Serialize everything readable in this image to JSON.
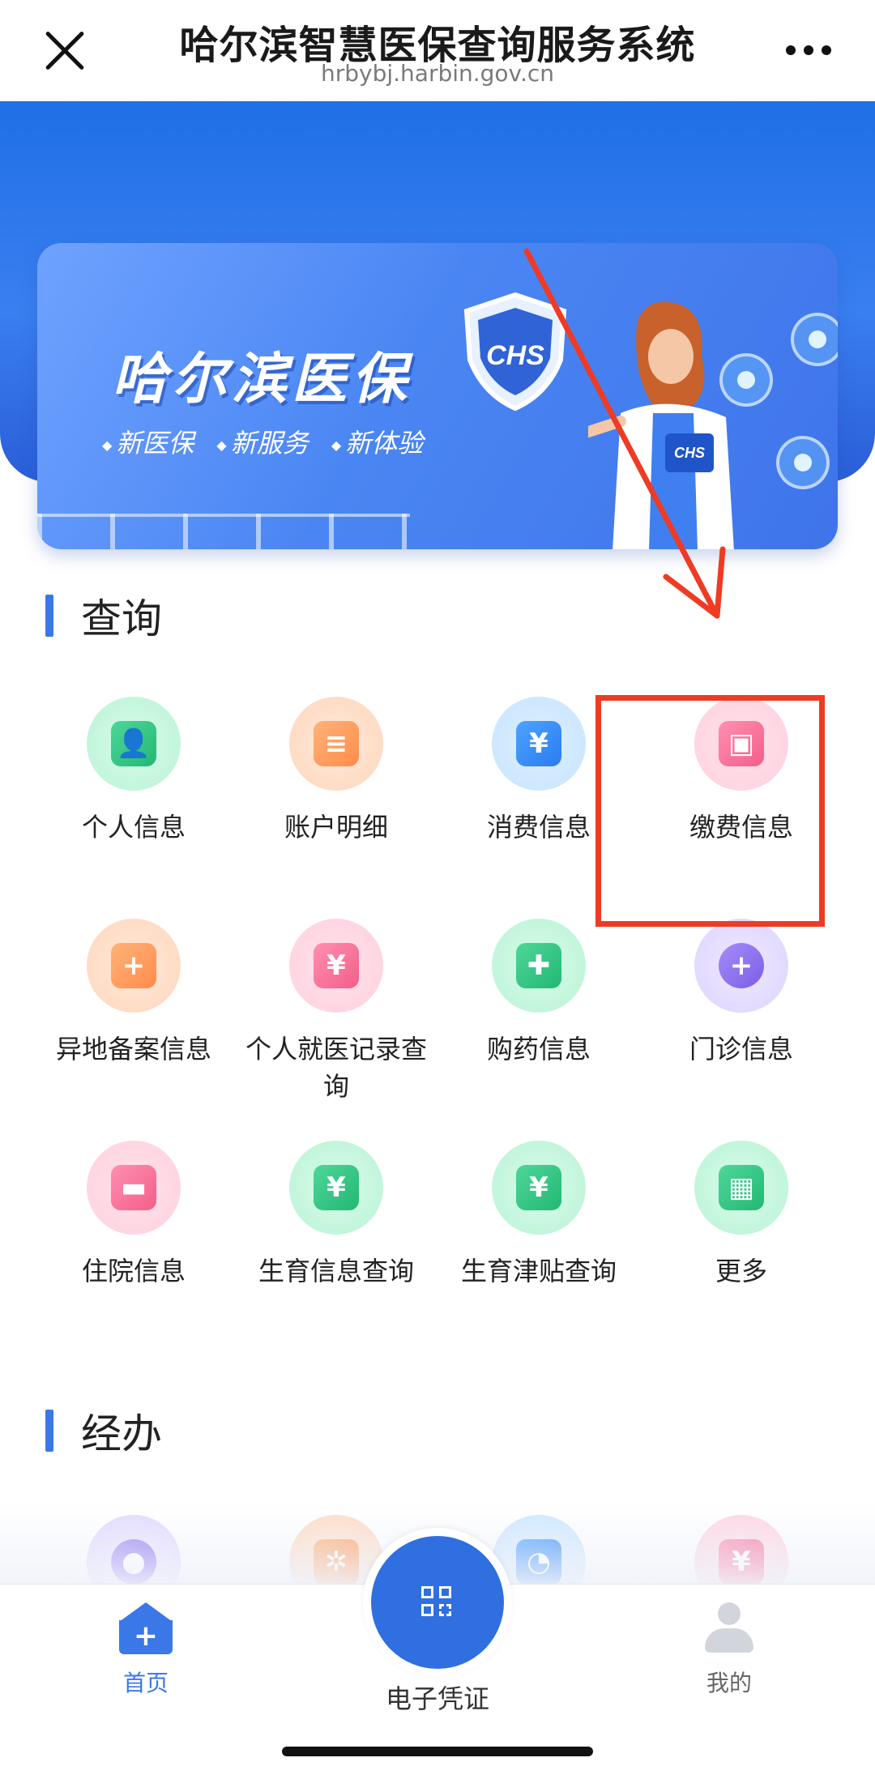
{
  "header": {
    "title": "哈尔滨智慧医保查询服务系统",
    "url": "hrbybj.harbin.gov.cn"
  },
  "banner": {
    "title": "哈尔滨医保",
    "tags": [
      "新医保",
      "新服务",
      "新体验"
    ],
    "shield_text": "CHS",
    "badge_text": "CHS"
  },
  "query_section": {
    "title": "查询",
    "items": [
      {
        "label": "个人信息",
        "icon": "person-card-icon",
        "color": "green",
        "glyph": "👤"
      },
      {
        "label": "账户明细",
        "icon": "account-detail-icon",
        "color": "orange",
        "glyph": "≡"
      },
      {
        "label": "消费信息",
        "icon": "consumption-icon",
        "color": "blue",
        "glyph": "¥"
      },
      {
        "label": "缴费信息",
        "icon": "payment-icon",
        "color": "pink",
        "glyph": "▣"
      },
      {
        "label": "异地备案信息",
        "icon": "remote-filing-icon",
        "color": "orange",
        "glyph": "+"
      },
      {
        "label": "个人就医记录查询",
        "icon": "medical-record-icon",
        "color": "pink",
        "glyph": "¥"
      },
      {
        "label": "购药信息",
        "icon": "medicine-purchase-icon",
        "color": "green",
        "glyph": "✚"
      },
      {
        "label": "门诊信息",
        "icon": "outpatient-icon",
        "color": "purple",
        "glyph": "+"
      },
      {
        "label": "住院信息",
        "icon": "hospitalization-icon",
        "color": "pink",
        "glyph": "▬"
      },
      {
        "label": "生育信息查询",
        "icon": "maternity-info-icon",
        "color": "green",
        "glyph": "¥"
      },
      {
        "label": "生育津贴查询",
        "icon": "maternity-allowance-icon",
        "color": "green",
        "glyph": "¥"
      },
      {
        "label": "更多",
        "icon": "more-apps-icon",
        "color": "green",
        "glyph": "▦"
      }
    ]
  },
  "handle_section": {
    "title": "经办",
    "items": [
      {
        "icon": "location-service-icon",
        "color": "purple",
        "glyph": "●"
      },
      {
        "icon": "settings-service-icon",
        "color": "orange",
        "glyph": "✲"
      },
      {
        "icon": "chat-service-icon",
        "color": "blue",
        "glyph": "◔"
      },
      {
        "icon": "bill-service-icon",
        "color": "pink",
        "glyph": "¥"
      }
    ]
  },
  "bottom_nav": {
    "home_label": "首页",
    "voucher_label": "电子凭证",
    "mine_label": "我的"
  },
  "colors": {
    "accent": "#3b78e7",
    "annotation": "#ef3b23"
  }
}
